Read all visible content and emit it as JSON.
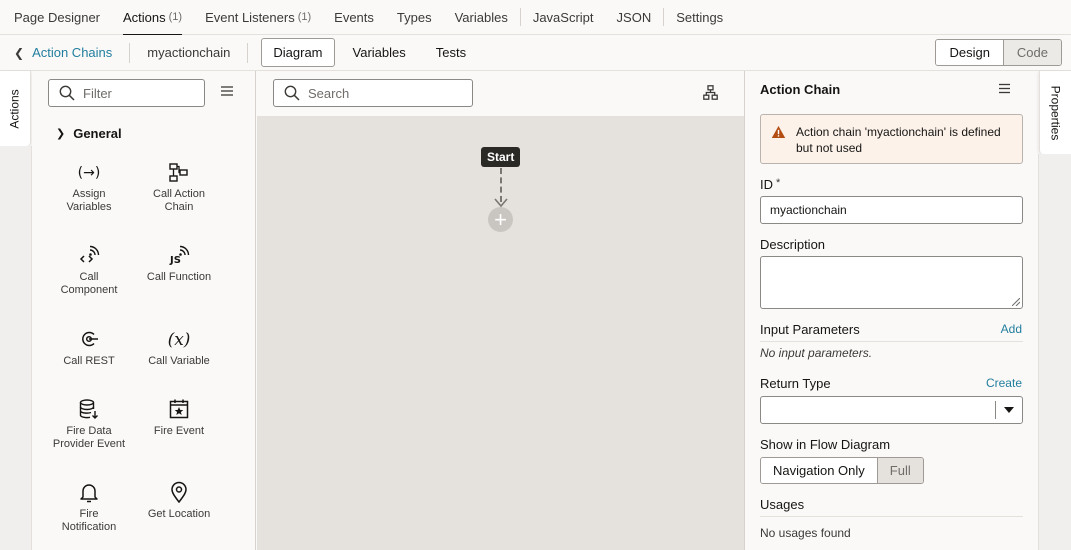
{
  "top_tabs": [
    {
      "label": "Page Designer",
      "count": ""
    },
    {
      "label": "Actions",
      "count": "(1)"
    },
    {
      "label": "Event Listeners",
      "count": "(1)"
    },
    {
      "label": "Events",
      "count": ""
    },
    {
      "label": "Types",
      "count": ""
    },
    {
      "label": "Variables",
      "count": ""
    },
    {
      "label": "JavaScript",
      "count": ""
    },
    {
      "label": "JSON",
      "count": ""
    },
    {
      "label": "Settings",
      "count": ""
    }
  ],
  "subbar": {
    "back_label": "Action Chains",
    "chain_name": "myactionchain",
    "tabs": [
      "Diagram",
      "Variables",
      "Tests"
    ],
    "design_label": "Design",
    "code_label": "Code"
  },
  "left_vtab": "Actions",
  "palette": {
    "filter_placeholder": "Filter",
    "group_label": "General",
    "items": [
      {
        "label1": "Assign",
        "label2": "Variables",
        "icon": "assign-icon"
      },
      {
        "label1": "Call Action",
        "label2": "Chain",
        "icon": "call-action-chain-icon"
      },
      {
        "label1": "Call",
        "label2": "Component",
        "icon": "call-component-icon"
      },
      {
        "label1": "Call Function",
        "label2": "",
        "icon": "js-function-icon"
      },
      {
        "label1": "Call REST",
        "label2": "",
        "icon": "rest-icon"
      },
      {
        "label1": "Call Variable",
        "label2": "",
        "icon": "variable-icon"
      },
      {
        "label1": "Fire Data",
        "label2": "Provider Event",
        "icon": "database-icon"
      },
      {
        "label1": "Fire Event",
        "label2": "",
        "icon": "calendar-star-icon"
      },
      {
        "label1": "Fire",
        "label2": "Notification",
        "icon": "bell-icon"
      },
      {
        "label1": "Get Location",
        "label2": "",
        "icon": "location-pin-icon"
      }
    ]
  },
  "canvas": {
    "search_placeholder": "Search",
    "start_label": "Start"
  },
  "properties": {
    "title": "Action Chain",
    "warning_text": "Action chain 'myactionchain' is defined but not used",
    "id_label": "ID",
    "id_required": "*",
    "id_value": "myactionchain",
    "description_label": "Description",
    "input_params_label": "Input Parameters",
    "add_label": "Add",
    "no_params_text": "No input parameters.",
    "return_type_label": "Return Type",
    "create_label": "Create",
    "flow_label": "Show in Flow Diagram",
    "nav_only_label": "Navigation Only",
    "full_label": "Full",
    "usages_label": "Usages",
    "no_usages_text": "No usages found"
  },
  "right_vtab": "Properties",
  "colors": {
    "link": "#227e9e",
    "warning_bg": "#fcf2ea",
    "canvas_bg": "#e5e2de"
  }
}
